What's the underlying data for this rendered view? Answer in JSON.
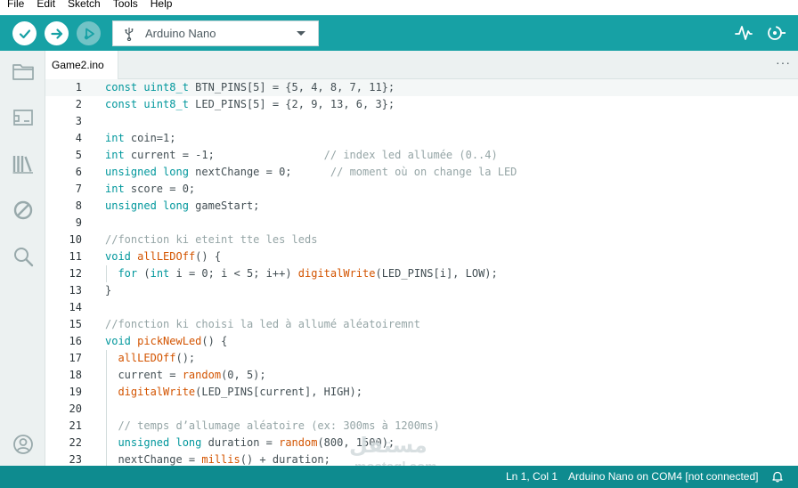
{
  "menu": {
    "items": [
      "File",
      "Edit",
      "Sketch",
      "Tools",
      "Help"
    ]
  },
  "toolbar": {
    "board_name": "Arduino Nano",
    "verify_icon": "checkmark-icon",
    "upload_icon": "arrow-right-icon",
    "debug_icon": "debug-icon",
    "serial_plotter_icon": "serial-plotter-icon",
    "serial_monitor_icon": "serial-monitor-icon"
  },
  "tabs": [
    {
      "label": "Game2.ino"
    }
  ],
  "editor": {
    "lines": [
      {
        "n": "1",
        "html": "<span class=\"kw\">const</span> <span class=\"kw\">uint8_t</span> BTN_PINS[5] = {5, 4, 8, 7, 11};"
      },
      {
        "n": "2",
        "html": "<span class=\"kw\">const</span> <span class=\"kw\">uint8_t</span> LED_PINS[5] = {2, 9, 13, 6, 3};"
      },
      {
        "n": "3",
        "html": ""
      },
      {
        "n": "4",
        "html": "<span class=\"kw\">int</span> coin=1;"
      },
      {
        "n": "5",
        "html": "<span class=\"kw\">int</span> current = -1;                 <span class=\"cm\">// index led allumée (0..4)</span>"
      },
      {
        "n": "6",
        "html": "<span class=\"kw\">unsigned</span> <span class=\"kw\">long</span> nextChange = 0;      <span class=\"cm\">// moment où on change la LED</span>"
      },
      {
        "n": "7",
        "html": "<span class=\"kw\">int</span> score = 0;"
      },
      {
        "n": "8",
        "html": "<span class=\"kw\">unsigned</span> <span class=\"kw\">long</span> gameStart;"
      },
      {
        "n": "9",
        "html": ""
      },
      {
        "n": "10",
        "html": "<span class=\"cm\">//fonction ki eteint tte les leds</span>"
      },
      {
        "n": "11",
        "html": "<span class=\"kw\">void</span> <span class=\"fn\">allLEDOff</span>() {"
      },
      {
        "n": "12",
        "html": "  <span class=\"kw\">for</span> (<span class=\"kw\">int</span> i = 0; i &lt; 5; i++) <span class=\"fn\">digitalWrite</span>(LED_PINS[i], LOW);"
      },
      {
        "n": "13",
        "html": "}"
      },
      {
        "n": "14",
        "html": ""
      },
      {
        "n": "15",
        "html": "<span class=\"cm\">//fonction ki choisi la led à allumé aléatoiremnt</span>"
      },
      {
        "n": "16",
        "html": "<span class=\"kw\">void</span> <span class=\"fn\">pickNewLed</span>() {"
      },
      {
        "n": "17",
        "html": "  <span class=\"fn\">allLEDOff</span>();"
      },
      {
        "n": "18",
        "html": "  current = <span class=\"fn\">random</span>(0, 5);"
      },
      {
        "n": "19",
        "html": "  <span class=\"fn\">digitalWrite</span>(LED_PINS[current], HIGH);"
      },
      {
        "n": "20",
        "html": ""
      },
      {
        "n": "21",
        "html": "  <span class=\"cm\">// temps d’allumage aléatoire (ex: 300ms à 1200ms)</span>"
      },
      {
        "n": "22",
        "html": "  <span class=\"kw\">unsigned</span> <span class=\"kw\">long</span> duration = <span class=\"fn\">random</span>(800, 1500);"
      },
      {
        "n": "23",
        "html": "  nextChange = <span class=\"fn\">millis</span>() + duration;"
      }
    ]
  },
  "watermark": {
    "arabic": "مستقل",
    "latin": "mostaql.com"
  },
  "status": {
    "position": "Ln 1, Col 1",
    "board_port": "Arduino Nano on COM4 [not connected]"
  },
  "colors": {
    "toolbar": "#17a1a5",
    "statusbar": "#0e8b8f",
    "keyword": "#00979c",
    "function": "#d35400",
    "comment": "#95a5a6"
  }
}
